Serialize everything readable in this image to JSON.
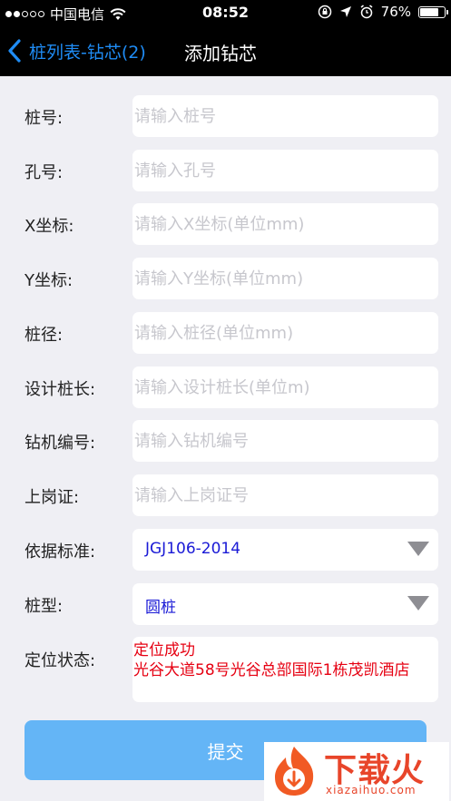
{
  "status_bar": {
    "carrier": "中国电信",
    "time": "08:52",
    "battery": "76%",
    "battery_level": 0.76
  },
  "nav": {
    "back_label": "桩列表-钻芯(2)",
    "title": "添加钻芯"
  },
  "form": {
    "pile_no": {
      "label": "桩号:",
      "placeholder": "请输入桩号"
    },
    "hole_no": {
      "label": "孔号:",
      "placeholder": "请输入孔号"
    },
    "x_coord": {
      "label": "X坐标:",
      "placeholder": "请输入X坐标(单位mm)"
    },
    "y_coord": {
      "label": "Y坐标:",
      "placeholder": "请输入Y坐标(单位mm)"
    },
    "pile_diameter": {
      "label": "桩径:",
      "placeholder": "请输入桩径(单位mm)"
    },
    "design_length": {
      "label": "设计桩长:",
      "placeholder": "请输入设计桩长(单位m)"
    },
    "drill_no": {
      "label": "钻机编号:",
      "placeholder": "请输入钻机编号"
    },
    "certificate": {
      "label": "上岗证:",
      "placeholder": "请输入上岗证号"
    },
    "standard": {
      "label": "依据标准:",
      "value": "JGJ106-2014"
    },
    "pile_type": {
      "label": "桩型:",
      "value": "圆桩"
    },
    "location": {
      "label": "定位状态:",
      "status": "定位成功",
      "address": "光谷大道58号光谷总部国际1栋茂凯酒店"
    }
  },
  "submit_label": "提交",
  "watermark": {
    "title": "下载火",
    "url": "xiazaihuo.com"
  }
}
